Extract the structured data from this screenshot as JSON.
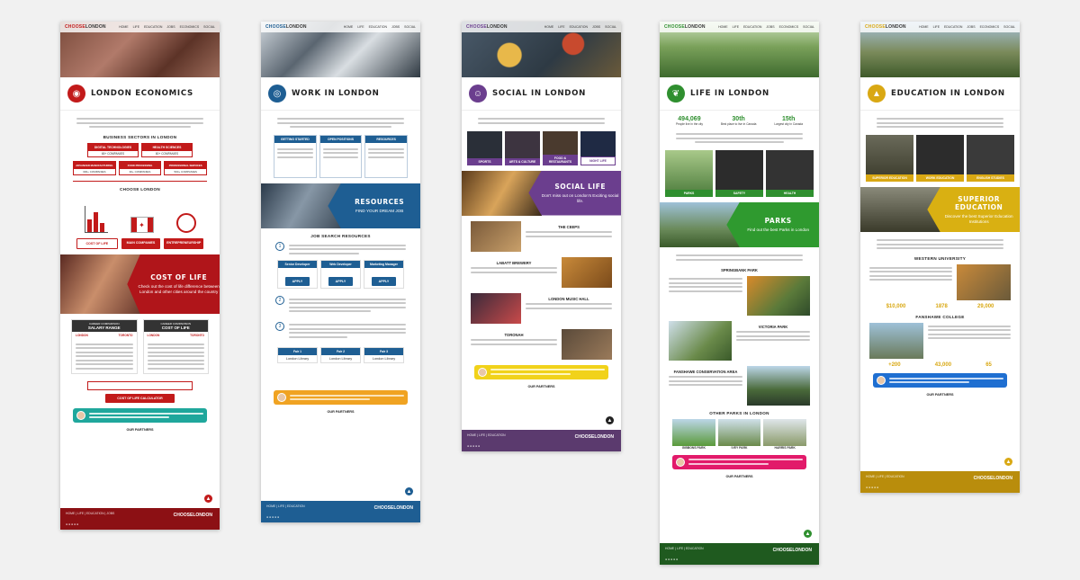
{
  "nav": [
    "HOME",
    "LIFE",
    "EDUCATION",
    "JOBS",
    "ECONOMICS",
    "SOCIAL"
  ],
  "brand": {
    "prefix": "CHOOSE",
    "name": "LONDON"
  },
  "pages": [
    {
      "title": "LONDON ECONOMICS",
      "accent": "#c21a1a",
      "icon": "globe-icon",
      "sectors_heading": "BUSINESS SECTORS IN LONDON",
      "sectors": [
        {
          "label": "DIGITAL TECHNOLOGIES",
          "s1": "65+ COMPANIES",
          "s2": "7 000+ EMPLOYEES"
        },
        {
          "label": "HEALTH SCIENCES",
          "s1": "80+ COMPANIES",
          "s2": "25 000+ EMPLOYEES"
        },
        {
          "label": "ADVANCED MANUFACTURING",
          "s1": "300+ COMPANIES",
          "s2": "35 000+ EMPLOYEES"
        },
        {
          "label": "FOOD PROCESSING",
          "s1": "30+ COMPANIES",
          "s2": "9 000+ EMPLOYEES"
        },
        {
          "label": "PROFESSIONAL SERVICES",
          "s1": "500+ COMPANIES",
          "s2": "15 000+ EMPLOYEES"
        }
      ],
      "choose_heading": "CHOOSE LONDON",
      "choose_buttons": [
        "COST OF LIFE",
        "MAIN COMPANIES",
        "ENTREPRENEURSHIP"
      ],
      "banner_title": "COST OF LIFE",
      "banner_text": "Check out the cost of life difference between London and other cities around the country",
      "compare": [
        {
          "heading": "CAREER COMPARISON",
          "title": "SALARY RANGE"
        },
        {
          "heading": "CAREER COMPARISON",
          "title": "COST OF LIFE"
        }
      ],
      "cities": [
        "LONDON",
        "TORONTO"
      ],
      "calc_button": "COST OF LIFE CALCULATOR",
      "partners": "OUR PARTNERS",
      "footer_links": [
        "HOME",
        "LIFE",
        "EDUCATION",
        "JOBS"
      ]
    },
    {
      "title": "WORK IN LONDON",
      "accent": "#1e5e93",
      "icon": "target-icon",
      "cards": [
        "GETTING STARTED",
        "OPEN POSITIONS",
        "RESOURCES"
      ],
      "banner_title": "RESOURCES",
      "banner_text": "FIND YOUR DREAM JOB",
      "job_heading": "JOB SEARCH RESOURCES",
      "steps": [
        "1",
        "2",
        "3"
      ],
      "jobs": [
        "Senior Developer",
        "Web Developer",
        "Marketing Manager"
      ],
      "apply": "APPLY",
      "fairs": [
        "Fair 1",
        "Fair 2",
        "Fair 3"
      ],
      "venue": "London Library",
      "partners": "OUR PARTNERS"
    },
    {
      "title": "SOCIAL IN LONDON",
      "accent": "#6b3e8e",
      "icon": "people-icon",
      "tiles": [
        "SPORTS",
        "ARTS & CULTURE",
        "FOOD & RESTAURANTS",
        "NIGHT LIFE"
      ],
      "banner_title": "SOCIAL LIFE",
      "banner_text": "Don't miss out on London's Exciting social life.",
      "venues": [
        "THE CEEPS",
        "LABATT BREWERY",
        "LONDON MUSIC HALL",
        "TORONAH"
      ],
      "partners": "OUR PARTNERS"
    },
    {
      "title": "LIFE IN LONDON",
      "accent": "#2f8f2f",
      "icon": "leaf-icon",
      "stats": [
        {
          "value": "494,069",
          "label": "People live in the city"
        },
        {
          "value": "30th",
          "label": "Best place to live in Canada"
        },
        {
          "value": "15th",
          "label": "Largest city in Canada"
        }
      ],
      "tiles": [
        "PARKS",
        "SAFETY",
        "HEALTH"
      ],
      "banner_title": "PARKS",
      "banner_text": "Find out the best Parks in London",
      "parks": [
        "SPRINGBANK PARK",
        "VICTORIA PARK",
        "FANSHAWE CONSERVATION AREA"
      ],
      "other_heading": "OTHER PARKS IN LONDON",
      "other_parks": [
        "GIBBONS PARK",
        "IVEY PARK",
        "HARRIS PARK"
      ],
      "partners": "OUR PARTNERS"
    },
    {
      "title": "EDUCATION IN LONDON",
      "accent": "#d9a813",
      "icon": "graduation-cap-icon",
      "tiles": [
        "SUPERIOR EDUCATION",
        "WORK EDUCATION",
        "ENGLISH STUDIES"
      ],
      "banner_title": "SUPERIOR EDUCATION",
      "banner_text": "Discover the best Superior Education Institutions",
      "schools": [
        {
          "name": "WESTERN UNIVERSITY",
          "stats": [
            "$10,000",
            "1878",
            "29,000"
          ]
        },
        {
          "name": "FANSHAWE COLLEGE",
          "stats": [
            "+200",
            "43,000",
            "65"
          ]
        }
      ],
      "partners": "OUR PARTNERS"
    }
  ]
}
